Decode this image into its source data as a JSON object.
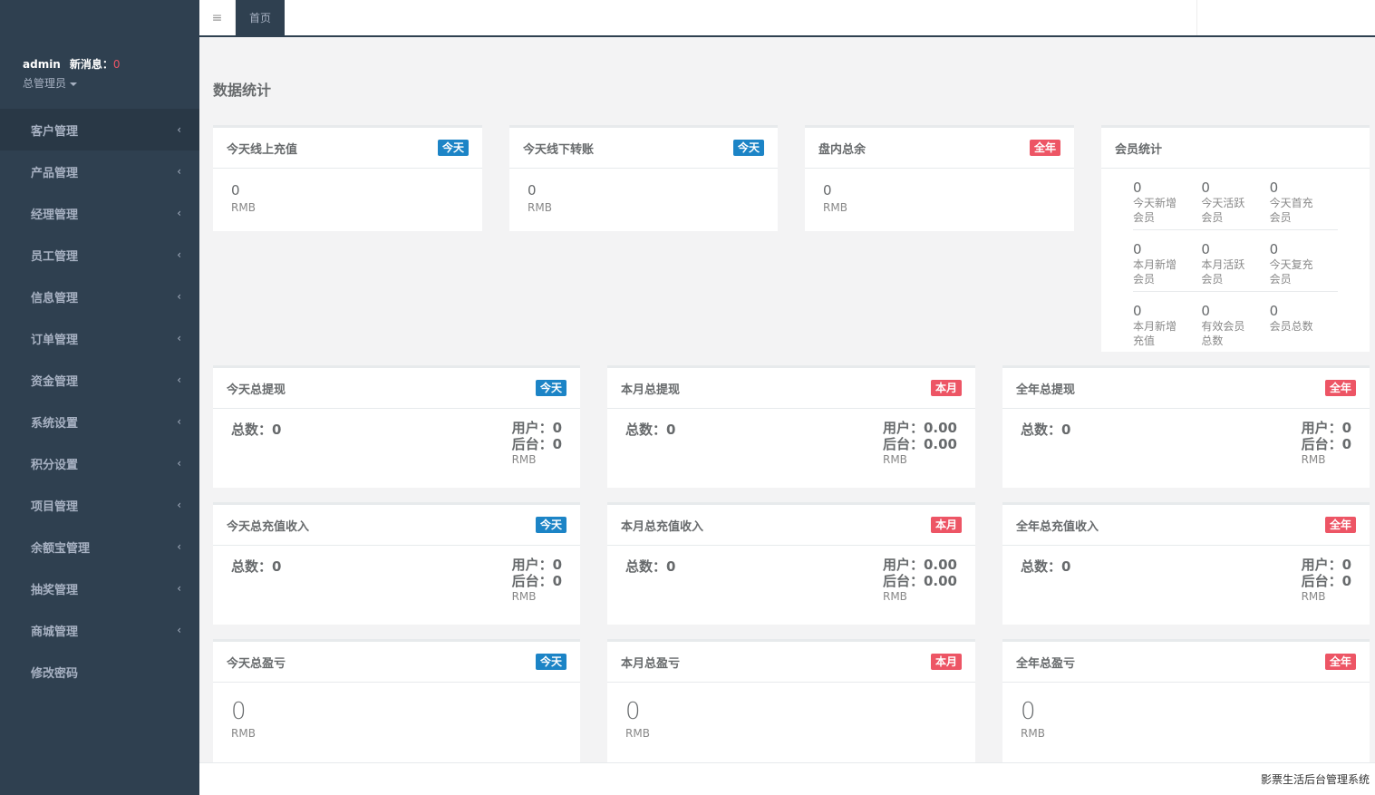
{
  "profile": {
    "username": "admin",
    "msg_label": "新消息：",
    "msg_count": "0",
    "role": "总管理员"
  },
  "nav": [
    {
      "label": "客户管理"
    },
    {
      "label": "产品管理"
    },
    {
      "label": "经理管理"
    },
    {
      "label": "员工管理"
    },
    {
      "label": "信息管理"
    },
    {
      "label": "订单管理"
    },
    {
      "label": "资金管理"
    },
    {
      "label": "系统设置"
    },
    {
      "label": "积分设置"
    },
    {
      "label": "项目管理"
    },
    {
      "label": "余额宝管理"
    },
    {
      "label": "抽奖管理"
    },
    {
      "label": "商城管理"
    },
    {
      "label": "修改密码"
    }
  ],
  "topbar": {
    "toggle_glyph": "≡",
    "home_tab": "首页"
  },
  "page_title": "数据统计",
  "labels": {
    "today": "今天",
    "month": "本月",
    "year": "全年"
  },
  "top_boxes": [
    {
      "title": "今天线上充值",
      "value": "0",
      "unit": "RMB"
    },
    {
      "title": "今天线下转账",
      "value": "0",
      "unit": "RMB"
    },
    {
      "title": "盘内总余",
      "value": "0",
      "unit": "RMB"
    }
  ],
  "member": {
    "title": "会员统计",
    "rows": [
      [
        {
          "num": "0",
          "lbl": "今天新增会员"
        },
        {
          "num": "0",
          "lbl": "今天活跃会员"
        },
        {
          "num": "0",
          "lbl": "今天首充会员"
        }
      ],
      [
        {
          "num": "0",
          "lbl": "本月新增会员"
        },
        {
          "num": "0",
          "lbl": "本月活跃会员"
        },
        {
          "num": "0",
          "lbl": "今天复充会员"
        }
      ],
      [
        {
          "num": "0",
          "lbl": "本月新增充值"
        },
        {
          "num": "0",
          "lbl": "有效会员总数"
        },
        {
          "num": "0",
          "lbl": "会员总数"
        }
      ]
    ]
  },
  "withdraw": [
    {
      "title": "今天总提现",
      "total": "总数：0",
      "user": "用户：0",
      "backend": "后台：0",
      "unit": "RMB"
    },
    {
      "title": "本月总提现",
      "total": "总数：0",
      "user": "用户：0.00",
      "backend": "后台：0.00",
      "unit": "RMB"
    },
    {
      "title": "全年总提现",
      "total": "总数：0",
      "user": "用户：0",
      "backend": "后台：0",
      "unit": "RMB"
    }
  ],
  "recharge": [
    {
      "title": "今天总充值收入",
      "total": "总数：0",
      "user": "用户：0",
      "backend": "后台：0",
      "unit": "RMB"
    },
    {
      "title": "本月总充值收入",
      "total": "总数：0",
      "user": "用户：0.00",
      "backend": "后台：0.00",
      "unit": "RMB"
    },
    {
      "title": "全年总充值收入",
      "total": "总数：0",
      "user": "用户：0",
      "backend": "后台：0",
      "unit": "RMB"
    }
  ],
  "profit": [
    {
      "title": "今天总盈亏",
      "value": "0",
      "unit": "RMB"
    },
    {
      "title": "本月总盈亏",
      "value": "0",
      "unit": "RMB"
    },
    {
      "title": "全年总盈亏",
      "value": "0",
      "unit": "RMB"
    }
  ],
  "footer": "影票生活后台管理系统"
}
